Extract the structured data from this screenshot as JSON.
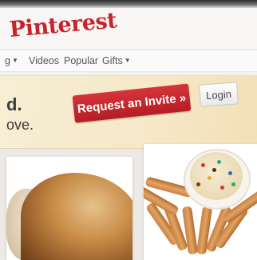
{
  "brand": {
    "logo_text": "Pinterest",
    "color": "#c8232c"
  },
  "nav": {
    "items": [
      {
        "label": "g",
        "has_dropdown": true
      },
      {
        "label": "Videos",
        "has_dropdown": false
      },
      {
        "label": "Popular",
        "has_dropdown": false
      },
      {
        "label": "Gifts",
        "has_dropdown": true
      }
    ],
    "dropdown_icon": "chevron-down-icon"
  },
  "banner": {
    "line1": "d.",
    "line2": "ove.",
    "request_button": "Request an Invite »",
    "login_button": "Login"
  },
  "colors": {
    "request_button": "#c9252c",
    "banner_bg": "#f6e8c7"
  },
  "pins": [
    {
      "image": "bread-photo"
    },
    {
      "image": "cookie-dough-dip-photo"
    }
  ]
}
